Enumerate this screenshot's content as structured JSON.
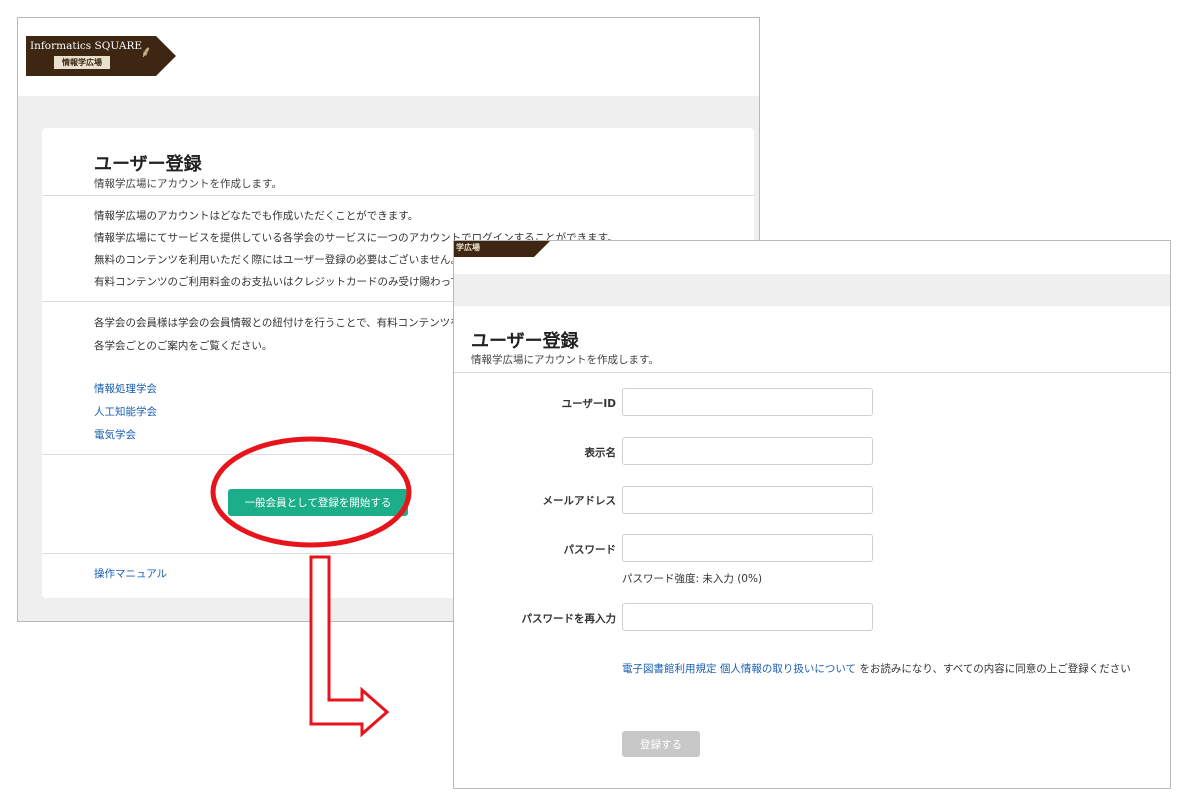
{
  "back_window": {
    "logo": {
      "name": "Informatics SQUARE",
      "sub": "情報学広場",
      "icon": "tree-icon"
    },
    "title": "ユーザー登録",
    "subtitle": "情報学広場にアカウントを作成します。",
    "intro_lines": [
      "情報学広場のアカウントはどなたでも作成いただくことができます。",
      "情報学広場にてサービスを提供している各学会のサービスに一つのアカウントでログインすることができます。",
      "無料のコンテンツを利用いただく際にはユーザー登録の必要はございません。",
      "有料コンテンツのご利用料金のお支払いはクレジットカードのみ受け賜わって"
    ],
    "member_lines": [
      "各学会の会員様は学会の会員情報との紐付けを行うことで、有料コンテンツを",
      "各学会ごとのご案内をご覧ください。"
    ],
    "society_links": [
      "情報処理学会",
      "人工知能学会",
      "電気学会"
    ],
    "start_button": "一般会員として登録を開始する",
    "manual_link": "操作マニュアル"
  },
  "front_window": {
    "logo_fragment": "学広場",
    "title": "ユーザー登録",
    "subtitle": "情報学広場にアカウントを作成します。",
    "fields": {
      "user_id": {
        "label": "ユーザーID",
        "value": ""
      },
      "display_name": {
        "label": "表示名",
        "value": ""
      },
      "email": {
        "label": "メールアドレス",
        "value": ""
      },
      "password": {
        "label": "パスワード",
        "value": ""
      },
      "password_confirm": {
        "label": "パスワードを再入力",
        "value": ""
      }
    },
    "password_strength": "パスワード強度: 未入力 (0%)",
    "agree": {
      "link1": "電子図書館利用規定",
      "link2": "個人情報の取り扱いについて",
      "text": "をお読みになり、すべての内容に同意の上ご登録ください"
    },
    "submit_button": "登録する"
  },
  "colors": {
    "highlight": "#e8141b",
    "start_button": "#1cae88",
    "link": "#1a5fb4",
    "logo_brown": "#3d2712"
  }
}
